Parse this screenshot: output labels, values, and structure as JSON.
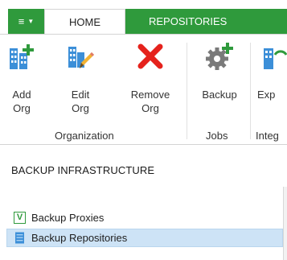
{
  "tabs": {
    "app_menu": "≡",
    "home": "HOME",
    "repositories": "REPOSITORIES"
  },
  "ribbon": {
    "buttons": {
      "add_org": "Add\nOrg",
      "edit_org": "Edit\nOrg",
      "remove_org": "Remove\nOrg",
      "backup": "Backup",
      "export": "Exp"
    },
    "groups": {
      "organization": "Organization",
      "jobs": "Jobs",
      "integration": "Integ"
    }
  },
  "nav": {
    "header": "BACKUP INFRASTRUCTURE",
    "items": [
      {
        "label": "Backup Proxies",
        "icon": "proxy-icon",
        "selected": false
      },
      {
        "label": "Backup Repositories",
        "icon": "repository-icon",
        "selected": true
      }
    ]
  },
  "colors": {
    "accent_green": "#2f9a3c",
    "icon_blue": "#3c8fd8",
    "remove_red": "#e5221c",
    "selection": "#cde3f6"
  }
}
